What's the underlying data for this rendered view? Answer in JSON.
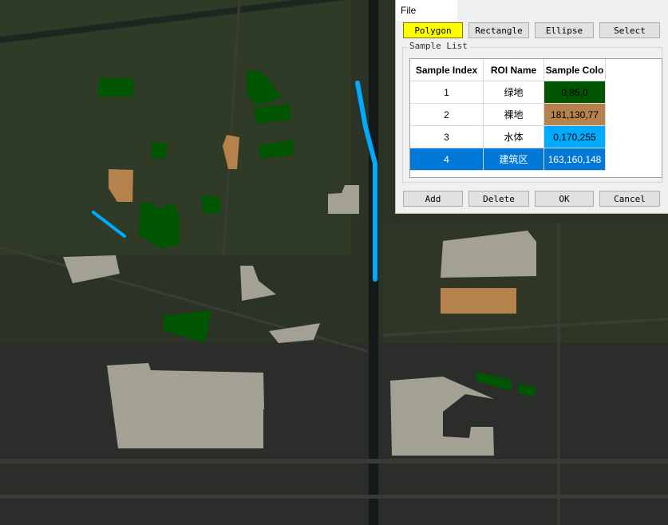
{
  "menu": {
    "file": "File"
  },
  "toolbar": {
    "buttons": [
      "Polygon",
      "Rectangle",
      "Ellipse",
      "Select"
    ],
    "active": "Polygon"
  },
  "sample_list": {
    "title": "Sample List",
    "columns": [
      "Sample Index",
      "ROI Name",
      "Sample Colo"
    ],
    "rows": [
      {
        "index": "1",
        "name": "绿地",
        "color_text": "0,85,0",
        "color": "#005500"
      },
      {
        "index": "2",
        "name": "裸地",
        "color_text": "181,130,77",
        "color": "#b5824d"
      },
      {
        "index": "3",
        "name": "水体",
        "color_text": "0,170,255",
        "color": "#00aaff"
      },
      {
        "index": "4",
        "name": "建筑区",
        "color_text": "163,160,148",
        "color": "#0078d7"
      }
    ],
    "selected_index": "4"
  },
  "actions": [
    "Add",
    "Delete",
    "OK",
    "Cancel"
  ],
  "colors": {
    "green_roi": "#005500",
    "bare_roi": "#b5824d",
    "water_roi": "#00aaff",
    "built_roi": "#a3a094",
    "active_tool": "#ffff00",
    "selection": "#0078d7"
  }
}
